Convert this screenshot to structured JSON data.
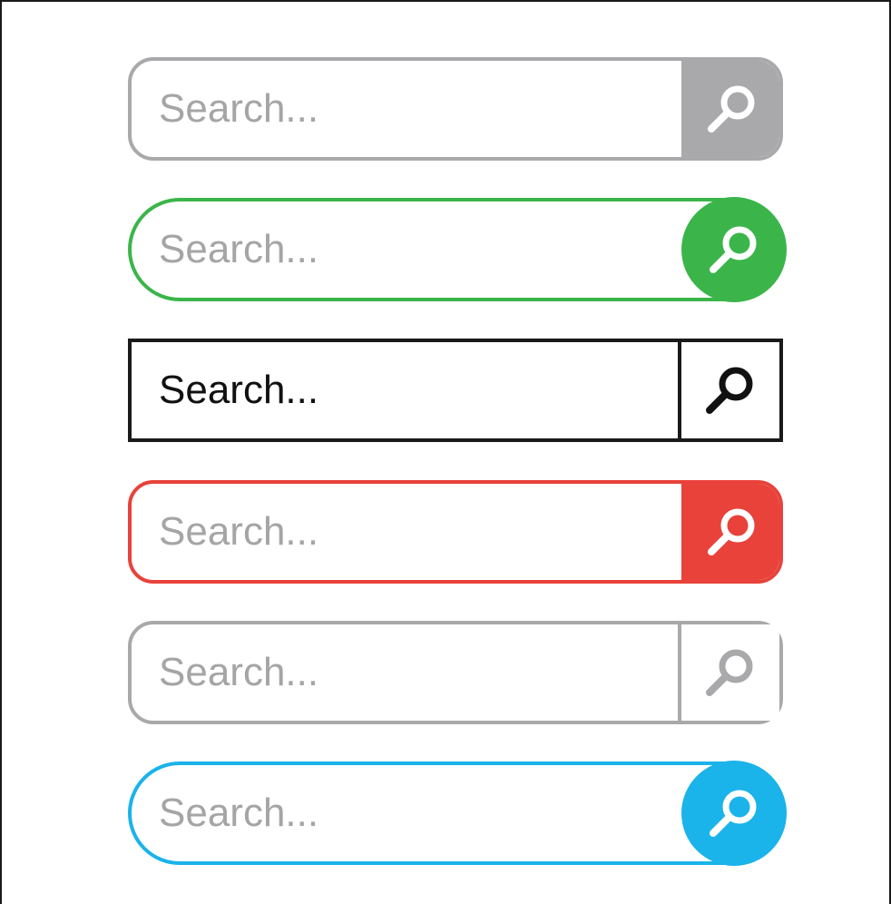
{
  "search_bars": [
    {
      "id": "grey-rounded",
      "placeholder": "Search...",
      "style": "rounded",
      "border_color": "#a9a9ab",
      "button_color": "#a9a9ab",
      "icon_color": "#ffffff",
      "icon": "magnifier-icon"
    },
    {
      "id": "green-pill",
      "placeholder": "Search...",
      "style": "pill",
      "border_color": "#3bb54a",
      "button_color": "#3bb54a",
      "icon_color": "#ffffff",
      "icon": "magnifier-icon"
    },
    {
      "id": "black-square",
      "placeholder": "Search...",
      "style": "square",
      "border_color": "#1a1a1a",
      "button_color": "#ffffff",
      "icon_color": "#111111",
      "icon": "magnifier-icon"
    },
    {
      "id": "red-rounded",
      "placeholder": "Search...",
      "style": "rounded",
      "border_color": "#e8423a",
      "button_color": "#e8423a",
      "icon_color": "#ffffff",
      "icon": "magnifier-icon"
    },
    {
      "id": "grey-outline",
      "placeholder": "Search...",
      "style": "rounded-outline",
      "border_color": "#a9a9ab",
      "button_color": "#ffffff",
      "icon_color": "#a9a9ab",
      "icon": "magnifier-icon"
    },
    {
      "id": "blue-pill",
      "placeholder": "Search...",
      "style": "pill",
      "border_color": "#1ab3ea",
      "button_color": "#1ab3ea",
      "icon_color": "#ffffff",
      "icon": "magnifier-icon"
    }
  ]
}
